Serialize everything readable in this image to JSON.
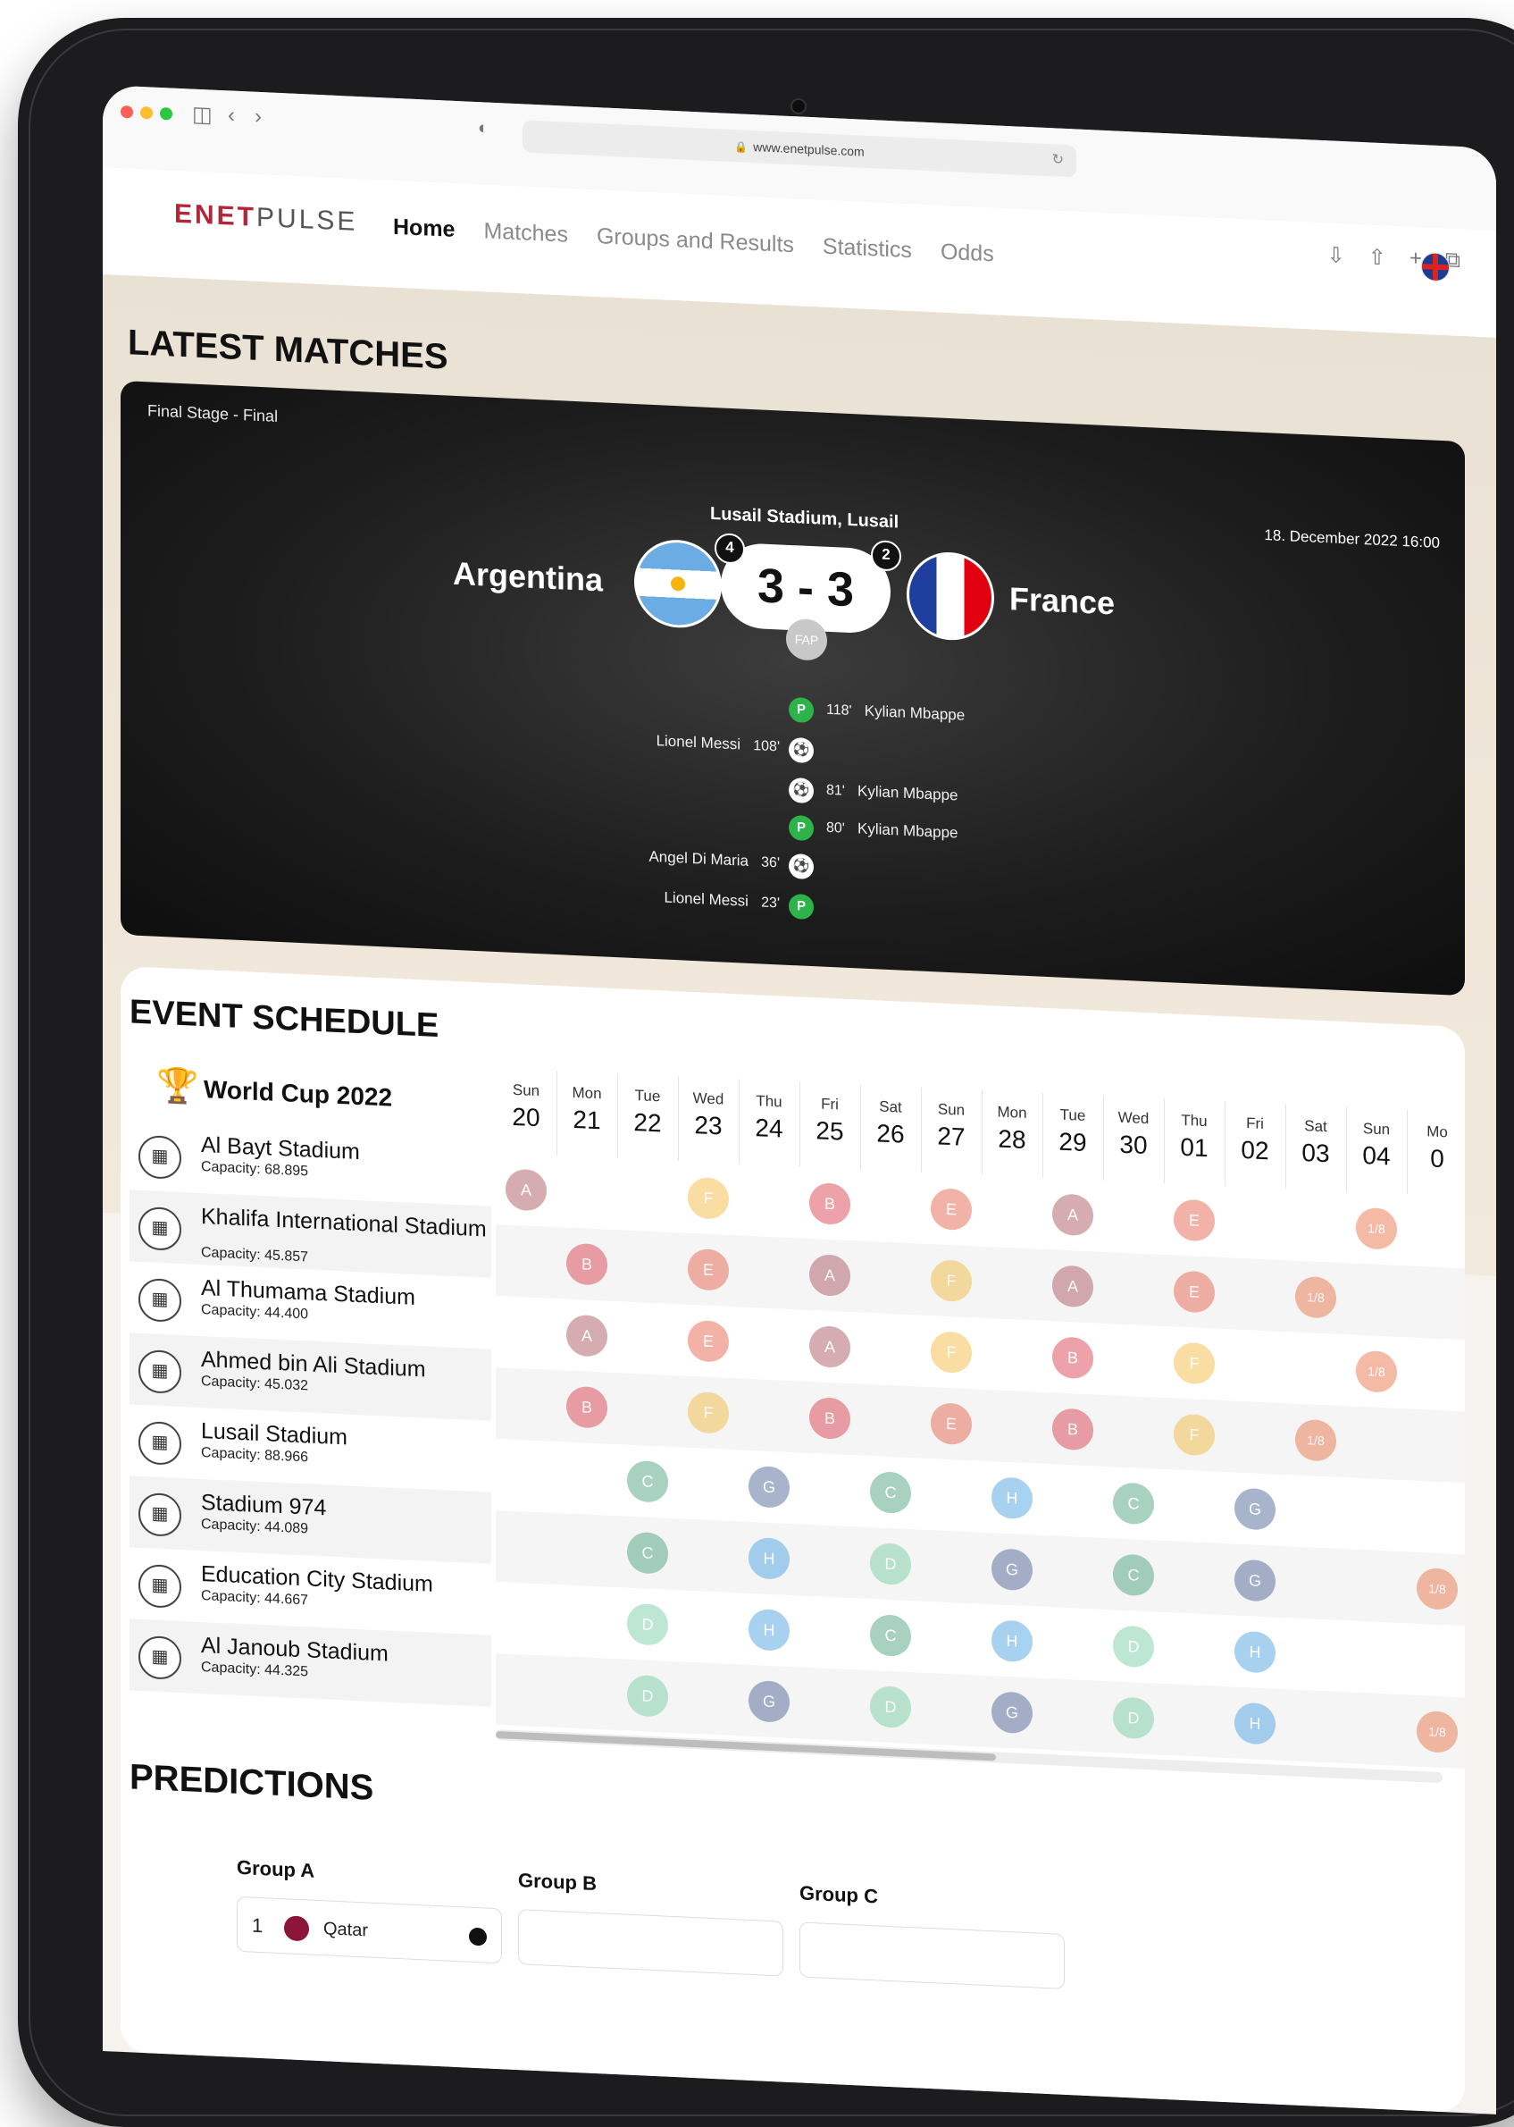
{
  "browser": {
    "url": "www.enetpulse.com"
  },
  "site": {
    "logo_a": "ENET",
    "logo_b": "PULSE",
    "nav": [
      "Home",
      "Matches",
      "Groups and Results",
      "Statistics",
      "Odds"
    ]
  },
  "latest": {
    "title": "LATEST MATCHES",
    "stage": "Final Stage - Final",
    "stadium": "Lusail Stadium, Lusail",
    "date": "18. December 2022 16:00",
    "home_team": "Argentina",
    "away_team": "France",
    "score": "3 - 3",
    "home_penalties": "4",
    "away_penalties": "2",
    "status": "FAP",
    "events": [
      {
        "side": "away",
        "minute": "118'",
        "player": "Kylian Mbappe",
        "type": "penalty"
      },
      {
        "side": "home",
        "minute": "108'",
        "player": "Lionel Messi",
        "type": "goal"
      },
      {
        "side": "away",
        "minute": "81'",
        "player": "Kylian Mbappe",
        "type": "goal"
      },
      {
        "side": "away",
        "minute": "80'",
        "player": "Kylian Mbappe",
        "type": "penalty"
      },
      {
        "side": "home",
        "minute": "36'",
        "player": "Angel Di Maria",
        "type": "goal"
      },
      {
        "side": "home",
        "minute": "23'",
        "player": "Lionel Messi",
        "type": "penalty"
      }
    ]
  },
  "schedule": {
    "title": "EVENT SCHEDULE",
    "tournament": "World Cup 2022",
    "days": [
      {
        "name": "Sun",
        "date": "20"
      },
      {
        "name": "Mon",
        "date": "21"
      },
      {
        "name": "Tue",
        "date": "22"
      },
      {
        "name": "Wed",
        "date": "23"
      },
      {
        "name": "Thu",
        "date": "24"
      },
      {
        "name": "Fri",
        "date": "25"
      },
      {
        "name": "Sat",
        "date": "26"
      },
      {
        "name": "Sun",
        "date": "27"
      },
      {
        "name": "Mon",
        "date": "28"
      },
      {
        "name": "Tue",
        "date": "29"
      },
      {
        "name": "Wed",
        "date": "30"
      },
      {
        "name": "Thu",
        "date": "01"
      },
      {
        "name": "Fri",
        "date": "02"
      },
      {
        "name": "Sat",
        "date": "03"
      },
      {
        "name": "Sun",
        "date": "04"
      },
      {
        "name": "Mo",
        "date": "0"
      }
    ],
    "stadiums": [
      {
        "name": "Al Bayt Stadium",
        "capacity": "Capacity: 68.895",
        "matches": [
          {
            "day": 0,
            "group": "A"
          },
          {
            "day": 3,
            "group": "F"
          },
          {
            "day": 5,
            "group": "B"
          },
          {
            "day": 7,
            "group": "E"
          },
          {
            "day": 9,
            "group": "A"
          },
          {
            "day": 11,
            "group": "E"
          },
          {
            "day": 14,
            "group": "1/8"
          }
        ]
      },
      {
        "name": "Khalifa International Stadium",
        "capacity": "Capacity: 45.857",
        "matches": [
          {
            "day": 1,
            "group": "B"
          },
          {
            "day": 3,
            "group": "E"
          },
          {
            "day": 5,
            "group": "A"
          },
          {
            "day": 7,
            "group": "F"
          },
          {
            "day": 9,
            "group": "A"
          },
          {
            "day": 11,
            "group": "E"
          },
          {
            "day": 13,
            "group": "1/8"
          }
        ]
      },
      {
        "name": "Al Thumama Stadium",
        "capacity": "Capacity: 44.400",
        "matches": [
          {
            "day": 1,
            "group": "A"
          },
          {
            "day": 3,
            "group": "E"
          },
          {
            "day": 5,
            "group": "A"
          },
          {
            "day": 7,
            "group": "F"
          },
          {
            "day": 9,
            "group": "B"
          },
          {
            "day": 11,
            "group": "F"
          },
          {
            "day": 14,
            "group": "1/8"
          }
        ]
      },
      {
        "name": "Ahmed bin Ali Stadium",
        "capacity": "Capacity: 45.032",
        "matches": [
          {
            "day": 1,
            "group": "B"
          },
          {
            "day": 3,
            "group": "F"
          },
          {
            "day": 5,
            "group": "B"
          },
          {
            "day": 7,
            "group": "E"
          },
          {
            "day": 9,
            "group": "B"
          },
          {
            "day": 11,
            "group": "F"
          },
          {
            "day": 13,
            "group": "1/8"
          }
        ]
      },
      {
        "name": "Lusail Stadium",
        "capacity": "Capacity: 88.966",
        "matches": [
          {
            "day": 2,
            "group": "C"
          },
          {
            "day": 4,
            "group": "G"
          },
          {
            "day": 6,
            "group": "C"
          },
          {
            "day": 8,
            "group": "H"
          },
          {
            "day": 10,
            "group": "C"
          },
          {
            "day": 12,
            "group": "G"
          }
        ]
      },
      {
        "name": "Stadium 974",
        "capacity": "Capacity: 44.089",
        "matches": [
          {
            "day": 2,
            "group": "C"
          },
          {
            "day": 4,
            "group": "H"
          },
          {
            "day": 6,
            "group": "D"
          },
          {
            "day": 8,
            "group": "G"
          },
          {
            "day": 10,
            "group": "C"
          },
          {
            "day": 12,
            "group": "G"
          },
          {
            "day": 15,
            "group": "1/8"
          }
        ]
      },
      {
        "name": "Education City Stadium",
        "capacity": "Capacity: 44.667",
        "matches": [
          {
            "day": 2,
            "group": "D"
          },
          {
            "day": 4,
            "group": "H"
          },
          {
            "day": 6,
            "group": "C"
          },
          {
            "day": 8,
            "group": "H"
          },
          {
            "day": 10,
            "group": "D"
          },
          {
            "day": 12,
            "group": "H"
          }
        ]
      },
      {
        "name": "Al Janoub Stadium",
        "capacity": "Capacity: 44.325",
        "matches": [
          {
            "day": 2,
            "group": "D"
          },
          {
            "day": 4,
            "group": "G"
          },
          {
            "day": 6,
            "group": "D"
          },
          {
            "day": 8,
            "group": "G"
          },
          {
            "day": 10,
            "group": "D"
          },
          {
            "day": 12,
            "group": "H"
          },
          {
            "day": 15,
            "group": "1/8"
          }
        ]
      }
    ],
    "group_colors": {
      "A": "#a34b54",
      "B": "#d8303f",
      "C": "#3f9b73",
      "D": "#6ecb9c",
      "E": "#e4573f",
      "F": "#f2b634",
      "G": "#41598f",
      "H": "#3f9be0",
      "1/8": "#e7683c"
    }
  },
  "predictions": {
    "title": "PREDICTIONS",
    "group_a": "Group A",
    "group_b": "Group B",
    "group_c": "Group C",
    "first_pos": "1",
    "first_team": "Qatar"
  }
}
